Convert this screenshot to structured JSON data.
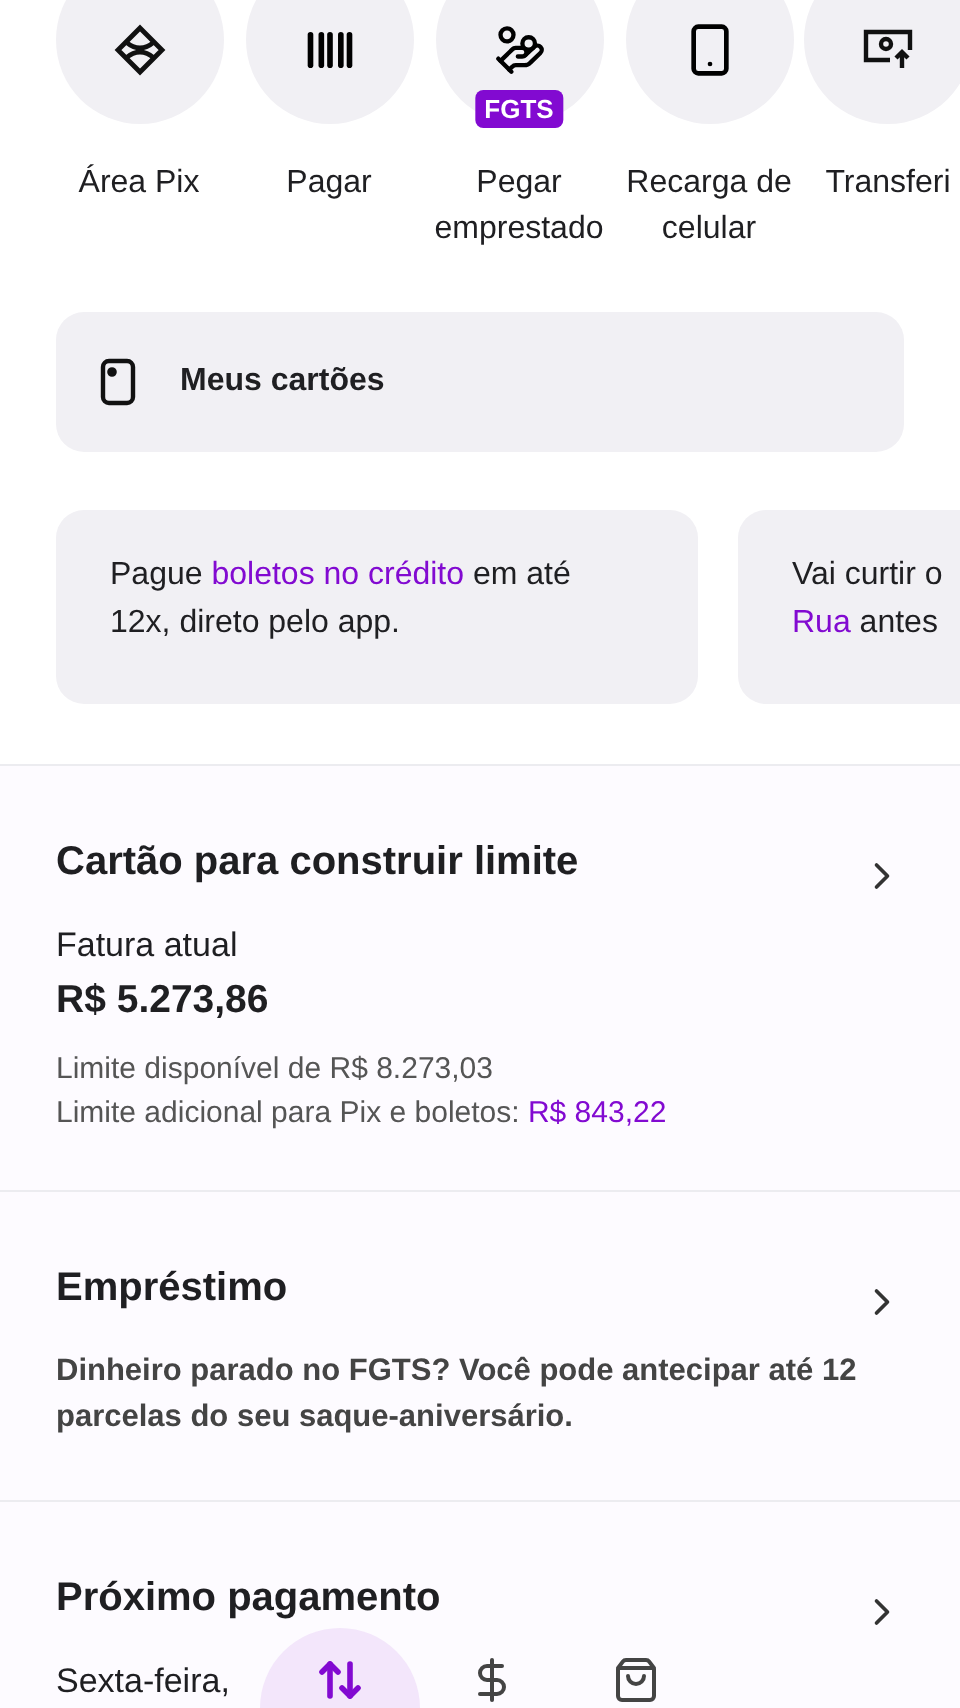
{
  "shortcuts": [
    {
      "kind": "pix",
      "label": "Área Pix"
    },
    {
      "kind": "barcode",
      "label": "Pagar"
    },
    {
      "kind": "loan",
      "label": "Pegar emprestado",
      "badge": "FGTS"
    },
    {
      "kind": "phone",
      "label": "Recarga de celular"
    },
    {
      "kind": "transfer",
      "label": "Transferi"
    }
  ],
  "cards_button": {
    "label": "Meus cartões"
  },
  "promos": [
    {
      "lines": [
        [
          {
            "text": "Pague ",
            "highlight": false
          },
          {
            "text": "boletos no crédito",
            "highlight": true
          },
          {
            "text": " em até",
            "highlight": false
          }
        ],
        [
          {
            "text": "12x, direto pelo app.",
            "highlight": false
          }
        ]
      ]
    },
    {
      "lines": [
        [
          {
            "text": "Vai curtir o",
            "highlight": false
          }
        ],
        [
          {
            "text": "Rua",
            "highlight": true
          },
          {
            "text": " antes",
            "highlight": false
          }
        ]
      ]
    }
  ],
  "credit_card": {
    "title": "Cartão para construir limite",
    "invoice_label": "Fatura atual",
    "invoice_amount": "R$ 5.273,86",
    "available_limit": "Limite disponível de R$ 8.273,03",
    "extra_limit_label": "Limite adicional para Pix e boletos:",
    "extra_limit_value": "R$ 843,22"
  },
  "loan": {
    "title": "Empréstimo",
    "description": "Dinheiro parado no FGTS? Você pode antecipar até 12 parcelas do seu saque-aniversário."
  },
  "next_payment": {
    "title": "Próximo pagamento",
    "date": "Sexta-feira,"
  },
  "bottom_nav": [
    {
      "kind": "transfers",
      "selected": true
    },
    {
      "kind": "money",
      "selected": false
    },
    {
      "kind": "shopping",
      "selected": false
    }
  ]
}
